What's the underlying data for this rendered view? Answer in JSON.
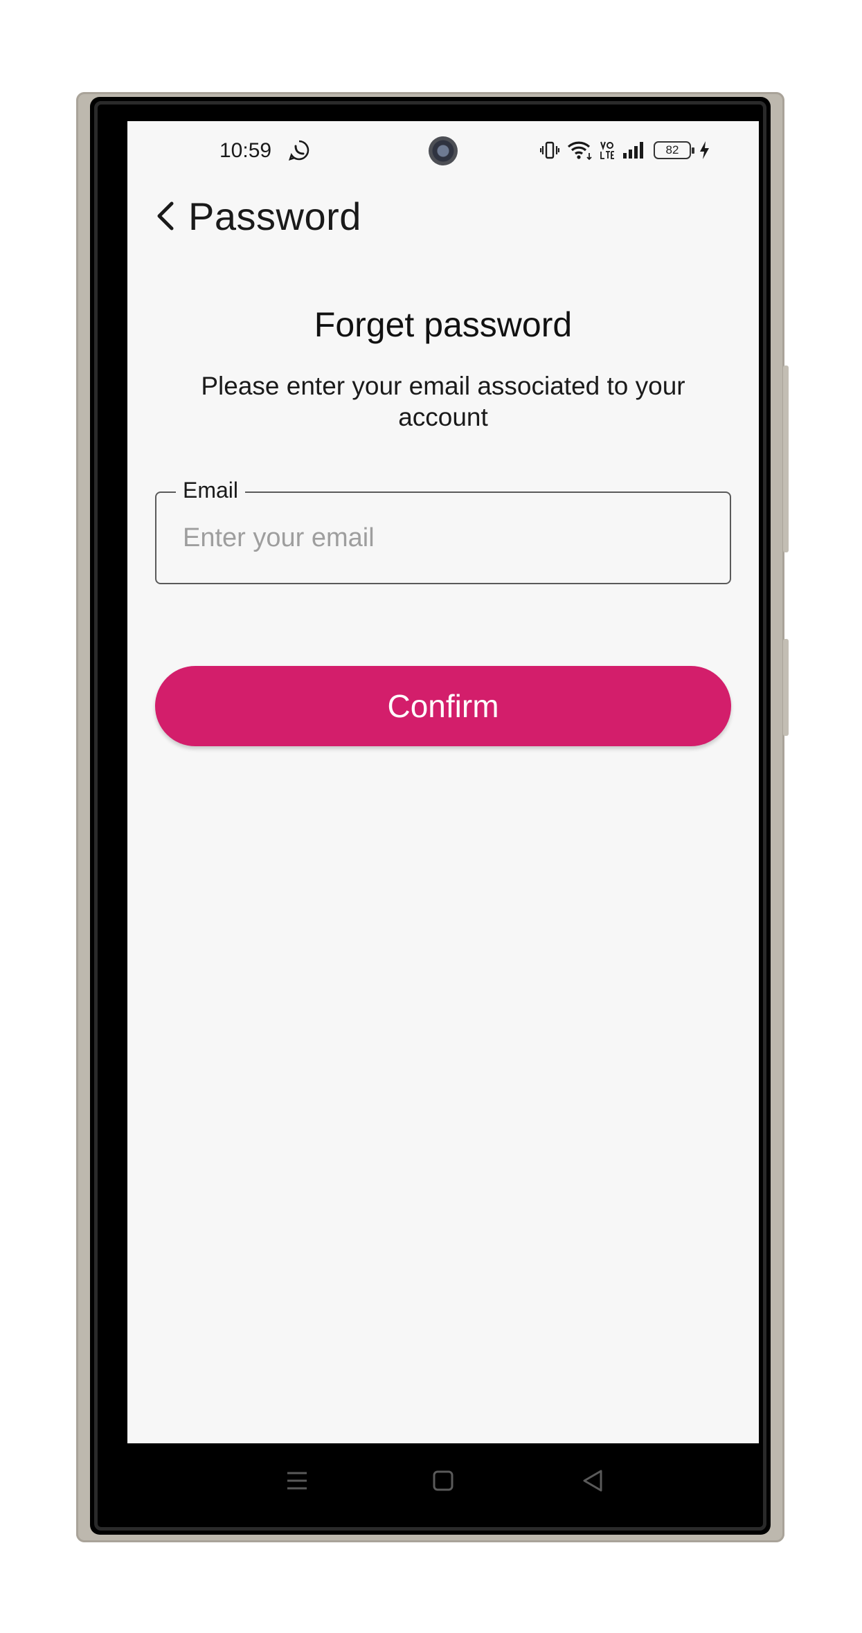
{
  "status_bar": {
    "time": "10:59",
    "battery_level": "82",
    "icons": [
      "whatsapp-status-icon",
      "vibrate-icon",
      "wifi-icon",
      "volte-icon",
      "signal-icon",
      "battery-icon",
      "charging-icon"
    ]
  },
  "app_bar": {
    "title": "Password",
    "back_icon": "chevron-left-icon"
  },
  "content": {
    "heading": "Forget password",
    "subtitle": "Please enter your email associated to your account",
    "email_field": {
      "label": "Email",
      "placeholder": "Enter your email",
      "value": ""
    },
    "confirm_button": {
      "label": "Confirm",
      "color": "#d31e6b"
    }
  },
  "nav_bar": {
    "icons": [
      "recents-icon",
      "home-icon",
      "back-icon"
    ]
  }
}
